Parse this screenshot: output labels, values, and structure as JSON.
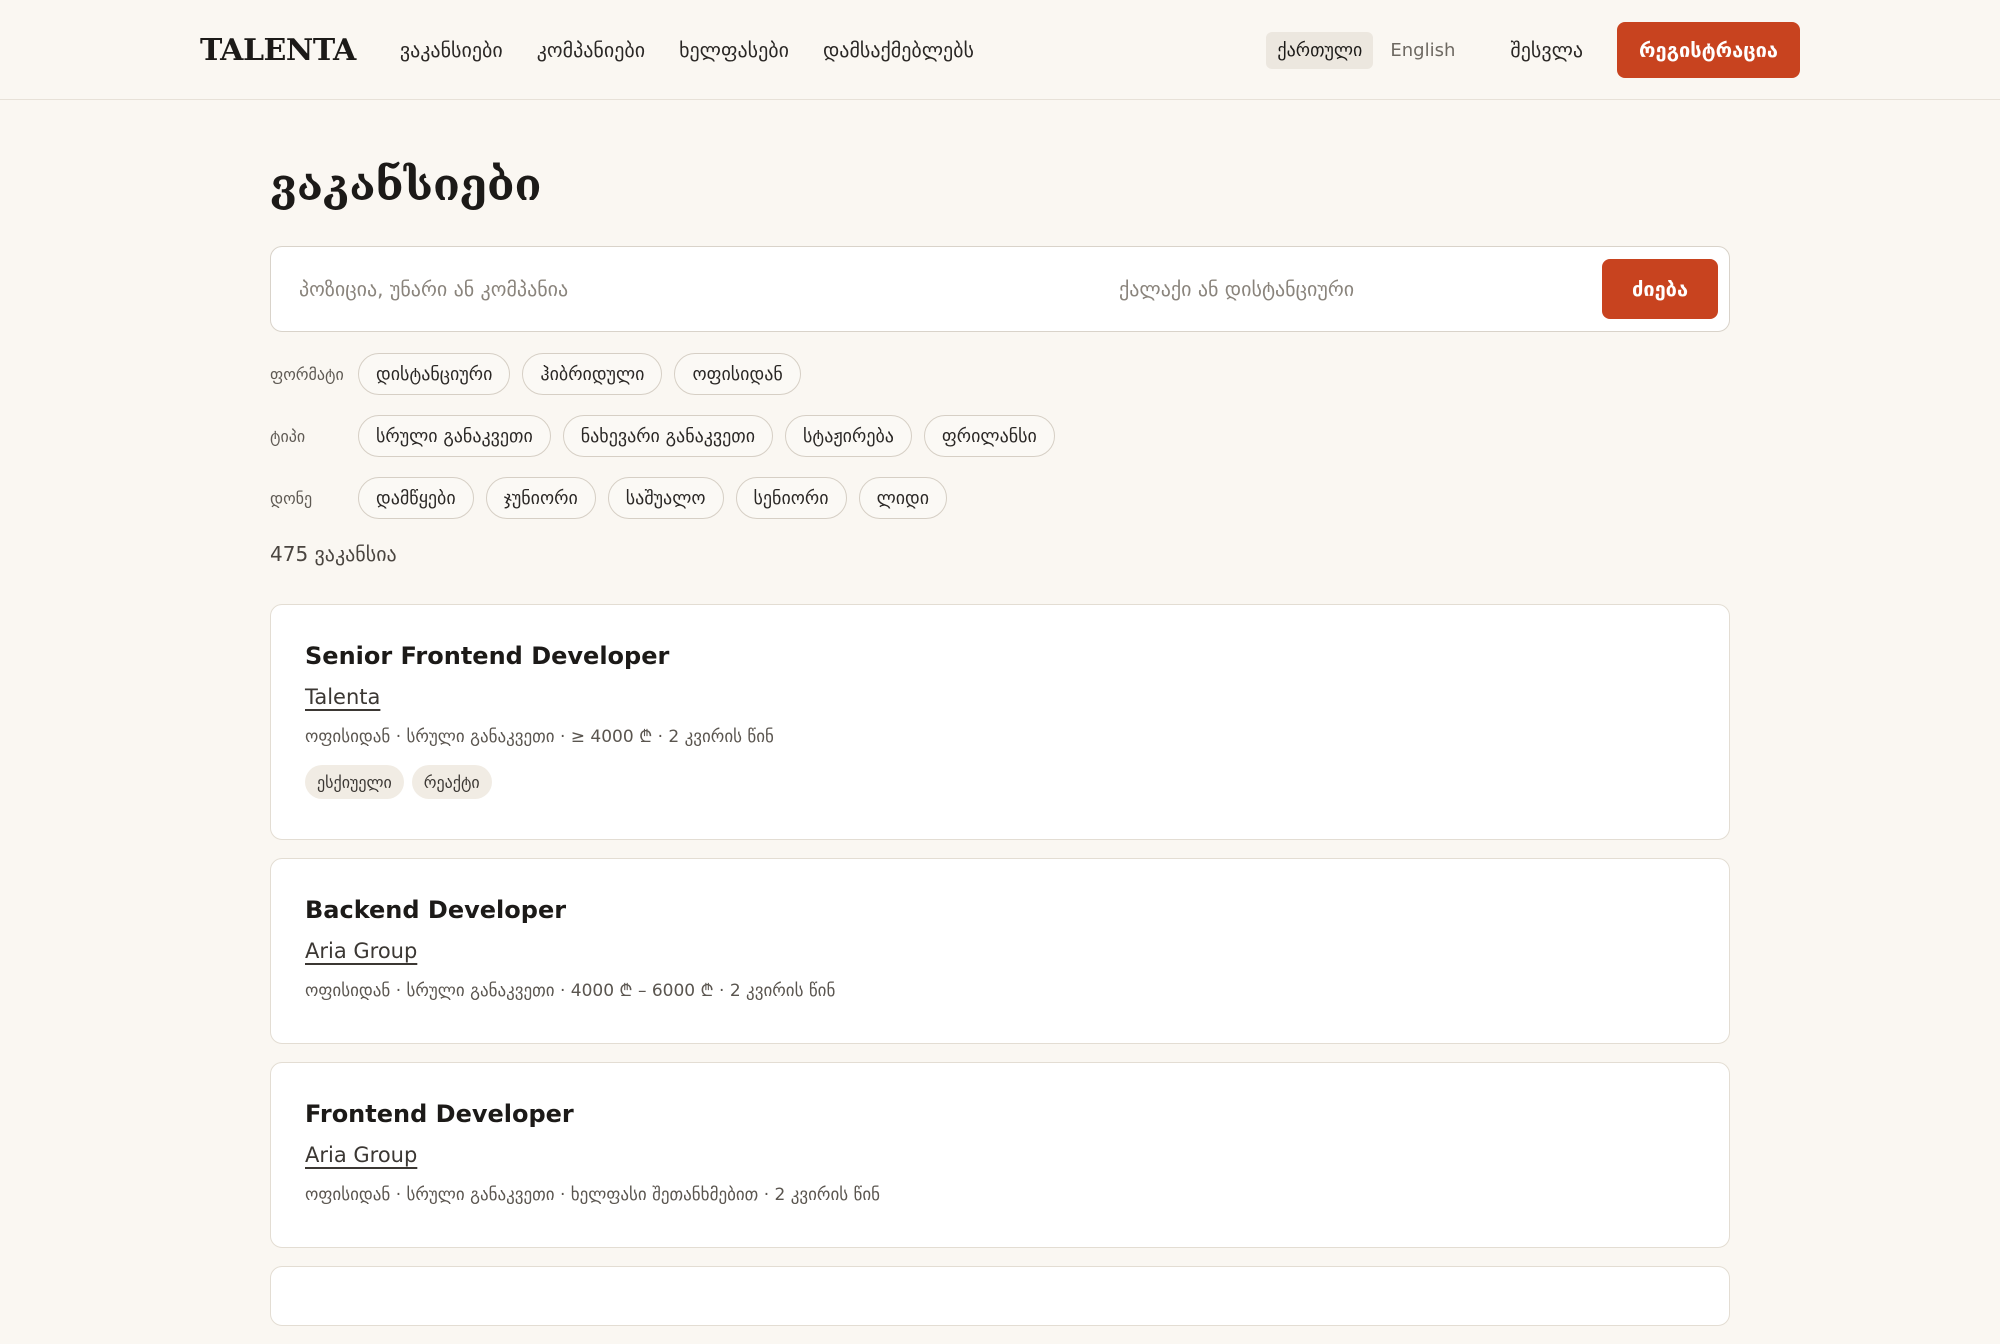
{
  "header": {
    "logo": "TALENTA",
    "nav": [
      "ვაკანსიები",
      "კომპანიები",
      "ხელფასები",
      "დამსაქმებლებს"
    ],
    "languages": [
      {
        "label": "ქართული",
        "active": true
      },
      {
        "label": "English",
        "active": false
      }
    ],
    "login_label": "შესვლა",
    "register_label": "რეგისტრაცია"
  },
  "page": {
    "title": "ვაკანსიები",
    "search": {
      "query_placeholder": "პოზიცია, უნარი ან კომპანია",
      "location_placeholder": "ქალაქი ან დისტანციური",
      "button_label": "ძიება"
    },
    "filters": [
      {
        "label": "ფორმატი",
        "options": [
          "დისტანციური",
          "ჰიბრიდული",
          "ოფისიდან"
        ]
      },
      {
        "label": "ტიპი",
        "options": [
          "სრული განაკვეთი",
          "ნახევარი განაკვეთი",
          "სტაჟირება",
          "ფრილანსი"
        ]
      },
      {
        "label": "დონე",
        "options": [
          "დამწყები",
          "ჯუნიორი",
          "საშუალო",
          "სენიორი",
          "ლიდი"
        ]
      }
    ],
    "count": "475 ვაკანსია"
  },
  "jobs": [
    {
      "title": "Senior Frontend Developer",
      "company": "Talenta",
      "meta": "ოფისიდან · სრული განაკვეთი · ≥ 4000 ₾ · 2 კვირის წინ",
      "tags": [
        "ესქიუელი",
        "რეაქტი"
      ]
    },
    {
      "title": "Backend Developer",
      "company": "Aria Group",
      "meta": "ოფისიდან · სრული განაკვეთი · 4000 ₾ – 6000 ₾ · 2 კვირის წინ",
      "tags": []
    },
    {
      "title": "Frontend Developer",
      "company": "Aria Group",
      "meta": "ოფისიდან · სრული განაკვეთი · ხელფასი შეთანხმებით · 2 კვირის წინ",
      "tags": []
    }
  ],
  "colors": {
    "accent": "#c8431f",
    "background": "#faf7f2",
    "card": "#ffffff"
  }
}
